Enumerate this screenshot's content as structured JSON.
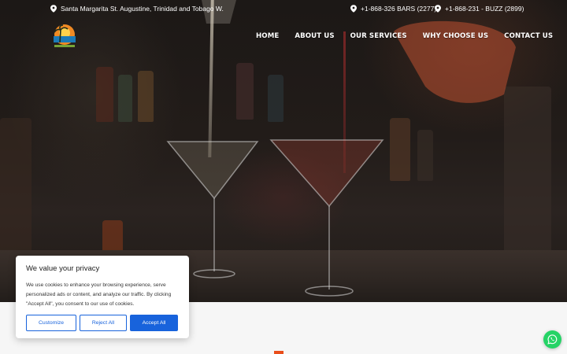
{
  "topbar": {
    "address": "Santa Margarita St. Augustine, Trinidad and Tobago W.",
    "phone_1": "+1-868-326 BARS (2277)",
    "phone_2": "+1-868-231 - BUZZ (2899)",
    "icon": "map-pin-icon"
  },
  "nav": {
    "items": [
      {
        "label": "HOME"
      },
      {
        "label": "ABOUT US"
      },
      {
        "label": "OUR SERVICES"
      },
      {
        "label": "WHY CHOOSE US"
      },
      {
        "label": "CONTACT US"
      }
    ]
  },
  "cookie_banner": {
    "title": "We value your privacy",
    "body": "We use cookies to enhance your browsing experience, serve personalized ads or content, and analyze our traffic. By clicking \"Accept All\", you consent to our use of cookies.",
    "customize_label": "Customize",
    "reject_label": "Reject All",
    "accept_label": "Accept All"
  },
  "colors": {
    "accent_blue": "#1863dc",
    "whatsapp_green": "#25d366",
    "accent_orange": "#e94e1b"
  },
  "icons": {
    "whatsapp": "whatsapp-icon",
    "logo": "sunset-palm-logo"
  }
}
